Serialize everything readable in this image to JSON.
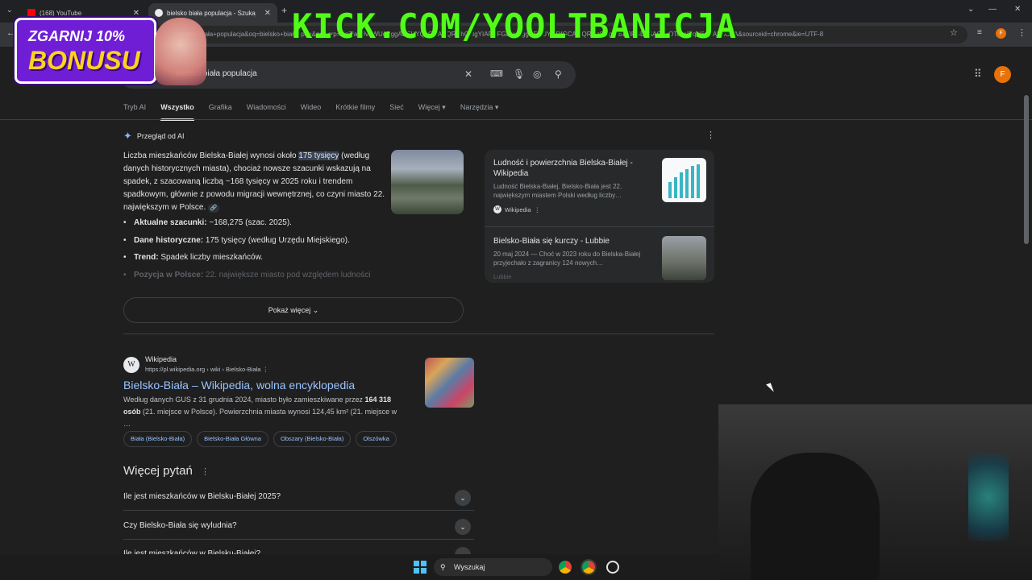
{
  "browser": {
    "tabs": [
      {
        "label": "(168) YouTube"
      },
      {
        "label": "bielsko biała populacja - Szukaj"
      }
    ],
    "new_tab": "+",
    "url": "…kolska+biała+populacja&oq=bielsko+biała+pop&gs_lcrp=EgZjaHJvbWUqBggAEEUYQjIGCAAQRRhCMgYIARBFGDkyBggCEEUYQDIGCAMQRRg8MgYIBBBFGDzSAQgyOTcxajBqN6gCALACAA&sourceid=chrome&ie=UTF-8",
    "profile_initial": "F"
  },
  "search": {
    "query": "bielsko biała populacja",
    "tabs": [
      "Tryb AI",
      "Wszystko",
      "Grafika",
      "Wiadomości",
      "Wideo",
      "Krótkie filmy",
      "Sieć",
      "Więcej",
      "Narzędzia"
    ],
    "active_tab": "Wszystko"
  },
  "ai_overview": {
    "heading": "Przegląd od AI",
    "text_before": "Liczba mieszkańców Bielska-Białej wynosi około ",
    "highlight": "175 tysięcy",
    "text_after": " (według danych historycznych miasta), chociaż nowsze szacunki wskazują na spadek, z szacowaną liczbą ~168 tysięcy w 2025 roku i trendem spadkowym, głównie z powodu migracji wewnętrznej, co czyni miasto 22. największym w Polsce.",
    "bullets": [
      {
        "label": "Aktualne szacunki:",
        "text": " ~168,275 (szac. 2025)."
      },
      {
        "label": "Dane historyczne:",
        "text": " 175 tysięcy (według Urzędu Miejskiego)."
      },
      {
        "label": "Trend:",
        "text": " Spadek liczby mieszkańców."
      },
      {
        "label": "Pozycja w Polsce:",
        "text": " 22. największe miasto pod względem ludności"
      }
    ],
    "show_more": "Pokaż więcej",
    "sources": [
      {
        "title": "Ludność i powierzchnia Bielska-Białej - Wikipedia",
        "snippet": "Ludność Bielska-Białej. Bielsko-Biała jest 22. największym miastem Polski według liczby…",
        "source": "Wikipedia"
      },
      {
        "title": "Bielsko-Biała się kurczy - Lubbie",
        "snippet": "20 maj 2024 — Choć w 2023 roku do Bielska-Białej przyjechało z zagranicy 124 nowych…",
        "source": "Lubbie"
      }
    ]
  },
  "result": {
    "site": "Wikipedia",
    "url": "https://pl.wikipedia.org › wiki › Bielsko-Biała",
    "title": "Bielsko-Biała – Wikipedia, wolna encyklopedia",
    "snippet_a": "Według danych GUS z 31 grudnia 2024, miasto było zamieszkiwane przez ",
    "snippet_bold": "164 318 osób",
    "snippet_b": " (21. miejsce w Polsce). Powierzchnia miasta wynosi 124,45 km² (21. miejsce w …",
    "chips": [
      "Biała (Bielsko-Biała)",
      "Bielsko-Biała Główna",
      "Obszary (Bielsko-Biała)",
      "Olszówka"
    ]
  },
  "more_questions": {
    "heading": "Więcej pytań",
    "items": [
      "Ile jest mieszkańców w Bielsku-Białej 2025?",
      "Czy Bielsko-Biała się wyludnia?",
      "Ile jest mieszkańców w Bielsku-Białej?"
    ]
  },
  "taskbar": {
    "search_label": "Wyszukaj"
  },
  "overlay": {
    "kick_text": "KICK.COM/YOOLTBANICJA",
    "bonus_line1": "ZGARNIJ 10%",
    "bonus_line2": "BONUSU"
  }
}
